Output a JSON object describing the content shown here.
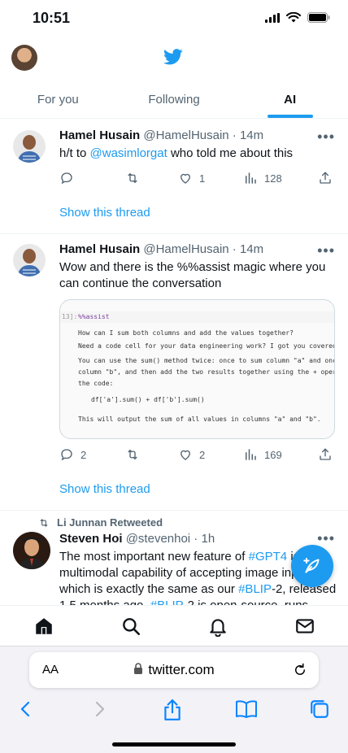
{
  "status": {
    "time": "10:51"
  },
  "tabs": [
    "For you",
    "Following",
    "AI"
  ],
  "tweets": [
    {
      "name": "Hamel Husain",
      "meta": "@HamelHusain · 14m",
      "text_prefix": "h/t to ",
      "text_link": "@wasimlorgat",
      "text_suffix": " who told me about this",
      "replies": "",
      "likes": "1",
      "views": "128",
      "thread": "Show this thread"
    },
    {
      "name": "Hamel Husain",
      "meta": "@HamelHusain · 14m",
      "text": "Wow and there is the %%assist magic where you can continue the conversation",
      "media": {
        "cell_num": "13]:",
        "magic": "%%assist",
        "question": "How can I sum both columns and add the values together?",
        "reply1": "Need a code cell for your data engineering work? I got you covered! 🔥",
        "reply2a": "You can use the sum() method twice: once to sum column \"a\" and once to sum",
        "reply2b": "column \"b\", and then add the two results together using the + operator. Here's",
        "reply2c": "the code:",
        "code": "df['a'].sum() + df['b'].sum()",
        "reply3": "This will output the sum of all values in columns \"a\" and \"b\"."
      },
      "replies": "2",
      "likes": "2",
      "views": "169",
      "thread": "Show this thread"
    },
    {
      "retweeted_by": "Li Junnan Retweeted",
      "name": "Steven Hoi",
      "meta": "@stevenhoi · 1h",
      "line1_a": "The most important new feature of ",
      "line1_link": "#GPT4",
      "line1_b": " is its",
      "line2": "multimodal capability of accepting image inputs,",
      "line3_a": "which is exactly the same as our ",
      "line3_link": "#BLIP",
      "line3_b": "-2, released",
      "line4_a": "1.5 months ago. ",
      "line4_link": "#BLIP",
      "line4_b": "-2 is open-source, runs"
    }
  ],
  "safari": {
    "aa": "AA",
    "url": "twitter.com"
  },
  "colors": {
    "accent": "#1d9bf0",
    "muted": "#536471"
  }
}
